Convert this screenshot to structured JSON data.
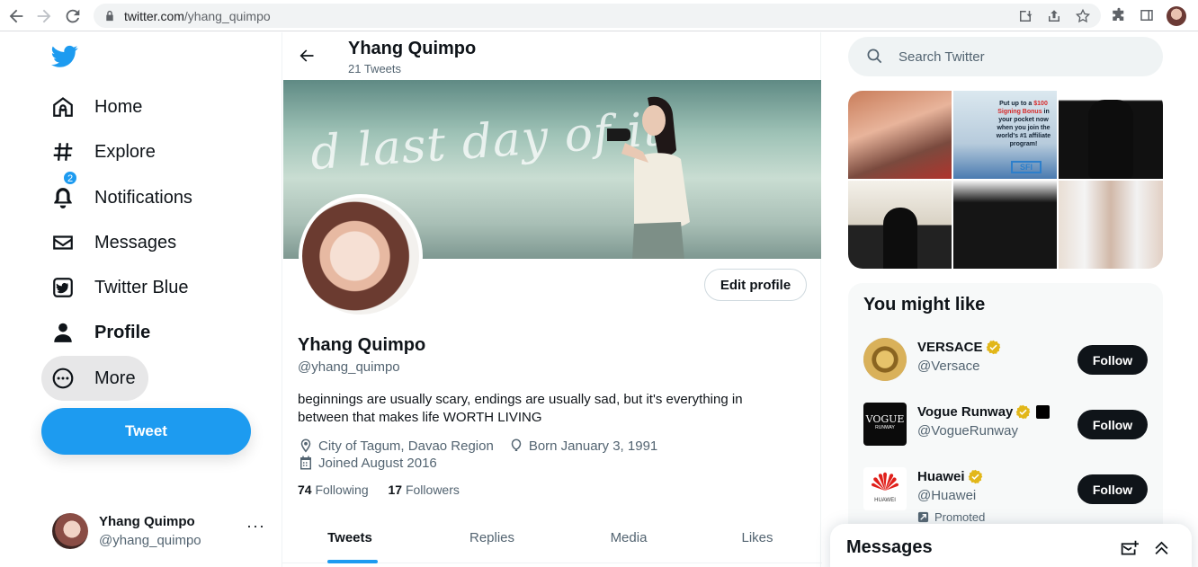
{
  "browser": {
    "url_host": "twitter.com",
    "url_path": "/yhang_quimpo"
  },
  "sidebar": {
    "items": [
      {
        "label": "Home",
        "icon": "home-icon"
      },
      {
        "label": "Explore",
        "icon": "hashtag-icon"
      },
      {
        "label": "Notifications",
        "icon": "bell-icon",
        "badge": "2"
      },
      {
        "label": "Messages",
        "icon": "envelope-icon"
      },
      {
        "label": "Twitter Blue",
        "icon": "twitter-blue-icon"
      },
      {
        "label": "Profile",
        "icon": "person-icon"
      },
      {
        "label": "More",
        "icon": "more-circle-icon"
      }
    ],
    "tweet_label": "Tweet",
    "account": {
      "name": "Yhang Quimpo",
      "handle": "@yhang_quimpo",
      "menu": "···"
    }
  },
  "header": {
    "name": "Yhang Quimpo",
    "tweet_count": "21 Tweets"
  },
  "banner": {
    "text": "d last day of it."
  },
  "profile": {
    "edit_label": "Edit profile",
    "name": "Yhang Quimpo",
    "handle": "@yhang_quimpo",
    "bio": "beginnings are usually scary, endings are usually sad, but it's everything in between that makes life WORTH LIVING",
    "location": "City of Tagum, Davao Region",
    "birthday": "Born January 3, 1991",
    "joined": "Joined August 2016",
    "following_count": "74",
    "following_label": "Following",
    "followers_count": "17",
    "followers_label": "Followers"
  },
  "tabs": [
    {
      "label": "Tweets",
      "active": true
    },
    {
      "label": "Replies",
      "active": false
    },
    {
      "label": "Media",
      "active": false
    },
    {
      "label": "Likes",
      "active": false
    }
  ],
  "search": {
    "placeholder": "Search Twitter"
  },
  "media_ad": {
    "line1": "Put up to a",
    "line2": "$100",
    "line3": "Signing Bonus",
    "line4": "in your pocket now when you join the world's #1 affiliate program!",
    "logo": "SFI"
  },
  "who_to_follow": {
    "title": "You might like",
    "items": [
      {
        "name": "VERSACE",
        "handle": "@Versace",
        "follow_label": "Follow"
      },
      {
        "name": "Vogue Runway",
        "handle": "@VogueRunway",
        "follow_label": "Follow",
        "avatar_text": "VOGUE",
        "avatar_sub": "RUNWAY"
      },
      {
        "name": "Huawei",
        "handle": "@Huawei",
        "follow_label": "Follow",
        "promoted": "Promoted",
        "avatar_text": "HUAWEI"
      }
    ]
  },
  "messages_drawer": {
    "title": "Messages"
  },
  "colors": {
    "accent": "#1d9bf0",
    "text": "#0f1419",
    "muted": "#536471",
    "verified_gold": "#e2b719"
  }
}
